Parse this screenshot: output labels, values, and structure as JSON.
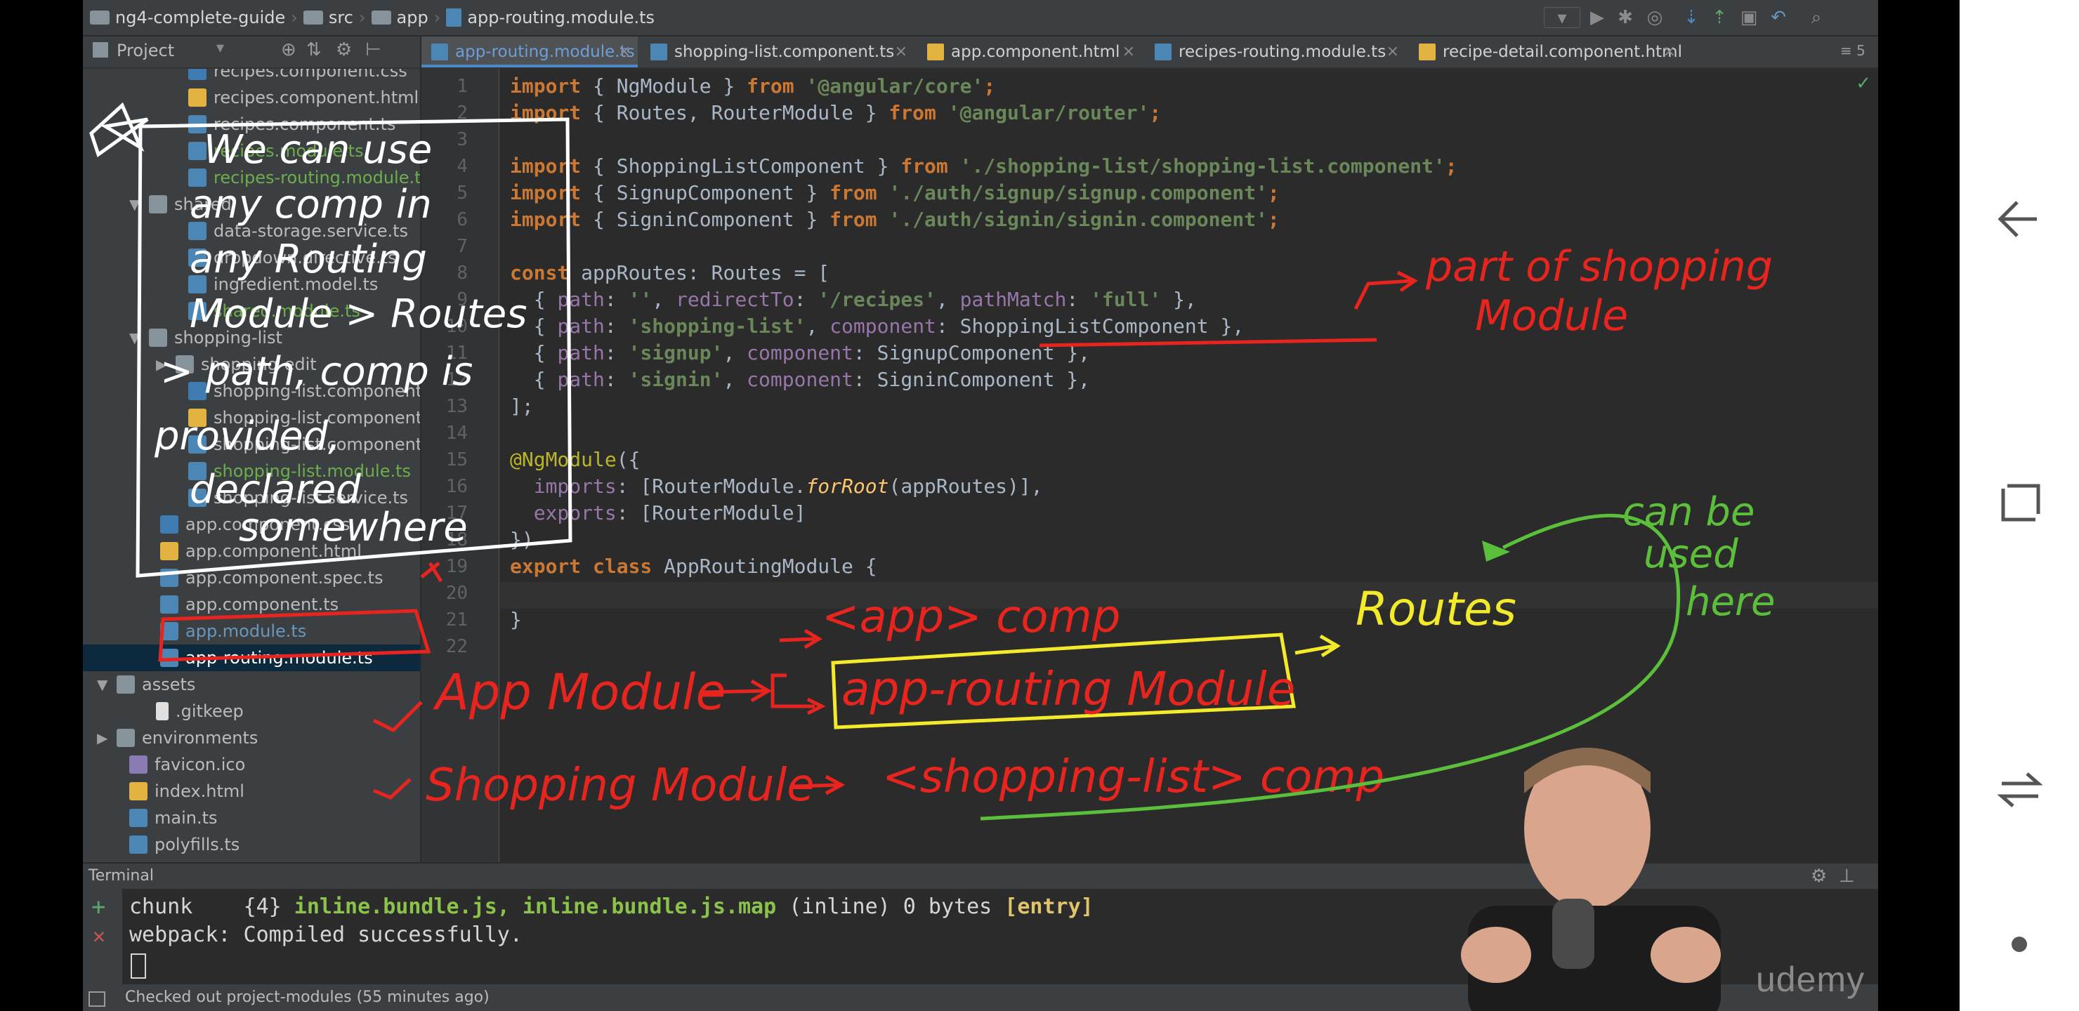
{
  "breadcrumb": {
    "project": "ng4-complete-guide",
    "src": "src",
    "app": "app",
    "file": "app-routing.module.ts"
  },
  "project_panel": {
    "label": "Project"
  },
  "tabs": [
    {
      "label": "app-routing.module.ts",
      "color": "#4c86b5"
    },
    {
      "label": "shopping-list.component.ts",
      "color": "#4c86b5"
    },
    {
      "label": "app.component.html",
      "color": "#e3b341"
    },
    {
      "label": "recipes-routing.module.ts",
      "color": "#4c86b5"
    },
    {
      "label": "recipe-detail.component.html",
      "color": "#e3b341"
    }
  ],
  "tabs_counter": "5",
  "tree": [
    {
      "label": "recipes.component.css",
      "icon": "css-file-icon"
    },
    {
      "label": "recipes.component.html",
      "icon": "html-file-icon"
    },
    {
      "label": "recipes.component.ts",
      "icon": "ts-file-icon"
    },
    {
      "label": "recipes.module.ts",
      "icon": "ts-file-icon"
    },
    {
      "label": "recipes-routing.module.ts",
      "icon": "ts-file-icon"
    },
    {
      "label": "shared",
      "icon": "folder-icon"
    },
    {
      "label": "data-storage.service.ts",
      "icon": "ts-file-icon"
    },
    {
      "label": "dropdown.directive.ts",
      "icon": "ts-file-icon"
    },
    {
      "label": "ingredient.model.ts",
      "icon": "ts-file-icon"
    },
    {
      "label": "shared.module.ts",
      "icon": "ts-file-icon"
    },
    {
      "label": "shopping-list",
      "icon": "folder-icon"
    },
    {
      "label": "shopping-edit",
      "icon": "folder-icon"
    },
    {
      "label": "shopping-list.component.css",
      "icon": "css-file-icon"
    },
    {
      "label": "shopping-list.component.html",
      "icon": "html-file-icon"
    },
    {
      "label": "shopping-list.component.ts",
      "icon": "ts-file-icon"
    },
    {
      "label": "shopping-list.module.ts",
      "icon": "ts-file-icon"
    },
    {
      "label": "shopping-list.service.ts",
      "icon": "ts-file-icon"
    },
    {
      "label": "app.component.css",
      "icon": "css-file-icon"
    },
    {
      "label": "app.component.html",
      "icon": "html-file-icon"
    },
    {
      "label": "app.component.spec.ts",
      "icon": "ts-file-icon"
    },
    {
      "label": "app.component.ts",
      "icon": "ts-file-icon"
    },
    {
      "label": "app.module.ts",
      "icon": "ts-file-icon"
    },
    {
      "label": "app-routing.module.ts",
      "icon": "ts-file-icon"
    },
    {
      "label": "assets",
      "icon": "folder-icon"
    },
    {
      "label": ".gitkeep",
      "icon": "file-icon"
    },
    {
      "label": "environments",
      "icon": "folder-icon"
    },
    {
      "label": "favicon.ico",
      "icon": "image-file-icon"
    },
    {
      "label": "index.html",
      "icon": "html-file-icon"
    },
    {
      "label": "main.ts",
      "icon": "ts-file-icon"
    },
    {
      "label": "polyfills.ts",
      "icon": "ts-file-icon"
    }
  ],
  "line_numbers": [
    "1",
    "2",
    "3",
    "4",
    "5",
    "6",
    "7",
    "8",
    "9",
    "10",
    "11",
    "12",
    "13",
    "14",
    "15",
    "16",
    "17",
    "18",
    "19",
    "20",
    "21",
    "22"
  ],
  "code": {
    "l1_kw": "import",
    "l1_a": " { NgModule } ",
    "l1_from": "from",
    "l1_str": " '@angular/core'",
    "l1_end": ";",
    "l2_kw": "import",
    "l2_a": " { Routes, RouterModule } ",
    "l2_from": "from",
    "l2_str": " '@angular/router'",
    "l2_end": ";",
    "l4_kw": "import",
    "l4_a": " { ShoppingListComponent } ",
    "l4_from": "from",
    "l4_str": " './shopping-list/shopping-list.component'",
    "l4_end": ";",
    "l5_kw": "import",
    "l5_a": " { SignupComponent } ",
    "l5_from": "from",
    "l5_str": " './auth/signup/signup.component'",
    "l5_end": ";",
    "l6_kw": "import",
    "l6_a": " { SigninComponent } ",
    "l6_from": "from",
    "l6_str": " './auth/signin/signin.component'",
    "l6_end": ";",
    "l8_kw": "const",
    "l8_a": " appRoutes: Routes = [",
    "l9_a": "  { ",
    "l9_p1": "path",
    "l9_b": ": ",
    "l9_s1": "''",
    "l9_c": ", ",
    "l9_p2": "redirectTo",
    "l9_d": ": ",
    "l9_s2": "'/recipes'",
    "l9_e": ", ",
    "l9_p3": "pathMatch",
    "l9_f": ": ",
    "l9_s3": "'full'",
    "l9_g": " },",
    "l10_a": "  { ",
    "l10_p1": "path",
    "l10_b": ": ",
    "l10_s1": "'shopping-list'",
    "l10_c": ", ",
    "l10_p2": "component",
    "l10_d": ": ShoppingListComponent },",
    "l11_a": "  { ",
    "l11_p1": "path",
    "l11_b": ": ",
    "l11_s1": "'signup'",
    "l11_c": ", ",
    "l11_p2": "component",
    "l11_d": ": SignupComponent },",
    "l12_a": "  { ",
    "l12_p1": "path",
    "l12_b": ": ",
    "l12_s1": "'signin'",
    "l12_c": ", ",
    "l12_p2": "component",
    "l12_d": ": SigninComponent },",
    "l13_a": "];",
    "l15_ann": "@NgModule",
    "l15_a": "({",
    "l16_a": "  ",
    "l16_p": "imports",
    "l16_b": ": [RouterModule.",
    "l16_fn": "forRoot",
    "l16_c": "(appRoutes)],",
    "l17_a": "  ",
    "l17_p": "exports",
    "l17_b": ": [RouterModule]",
    "l18_a": "})",
    "l19_kw": "export class",
    "l19_a": " AppRoutingModule {",
    "l21_a": "}"
  },
  "terminal": {
    "title": "Terminal",
    "line1_a": "chunk    ",
    "line1_b": "{4}",
    "line1_c": " inline.bundle.js, inline.bundle.js.map",
    "line1_d": " (inline) 0 bytes",
    "line1_e": " [entry]",
    "line2": "webpack: Compiled successfully."
  },
  "status": "Checked out project-modules (55 minutes ago)",
  "annotations": {
    "note_lines": [
      "We can use",
      "any comp in",
      "any Routing",
      "Module > Routes",
      "> path, comp is",
      "provided,",
      "declared",
      "somewhere"
    ],
    "part_of_shopping_1": "part of shopping",
    "part_of_shopping_2": "Module",
    "app_comp": "<app> comp",
    "app_routing_module": "app-routing Module",
    "routes": "Routes",
    "app_module": "App Module",
    "shopping_module": "Shopping Module",
    "shopping_list_comp": "<shopping-list> comp",
    "can_be_used_1": "can be",
    "can_be_used_2": "used",
    "can_be_used_3": "here"
  },
  "watermark": "udemy",
  "colors": {
    "ink_red": "#e8241f",
    "ink_white": "#ffffff",
    "ink_yellow": "#f2ea2a",
    "ink_green": "#5bbf3b"
  }
}
